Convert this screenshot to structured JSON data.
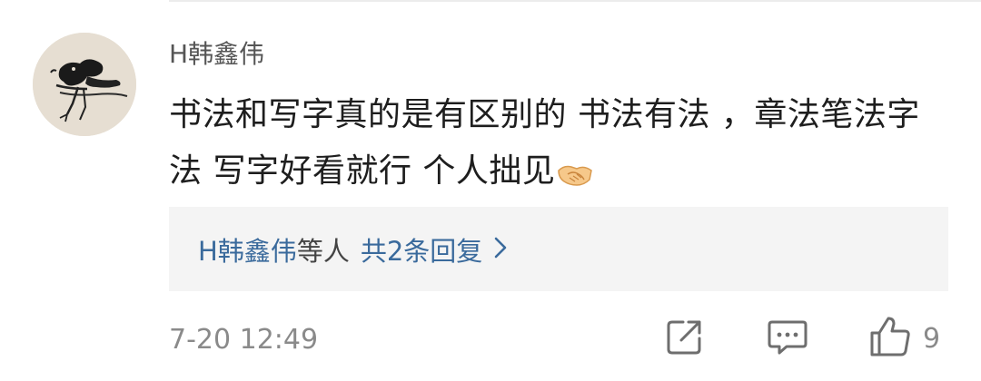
{
  "comment": {
    "username": "H韩鑫伟",
    "text_line1": "书法和写字真的是有区别的 书法有法 ，章法笔法字",
    "text_line2": "法 写字好看就行 个人拙见",
    "emoji": "handshake-emoji",
    "timestamp": "7-20 12:49",
    "like_count": "9"
  },
  "replies": {
    "names": "H韩鑫伟",
    "suffix": "等人",
    "count_label": "共2条回复"
  },
  "icons": {
    "share": "share-icon",
    "reply": "comment-icon",
    "like": "thumbs-up-icon",
    "chevron": "chevron-right-icon"
  },
  "colors": {
    "link_blue": "#3a6a9c",
    "meta_gray": "#8a8a8a",
    "reply_box_bg": "#f4f4f4"
  }
}
